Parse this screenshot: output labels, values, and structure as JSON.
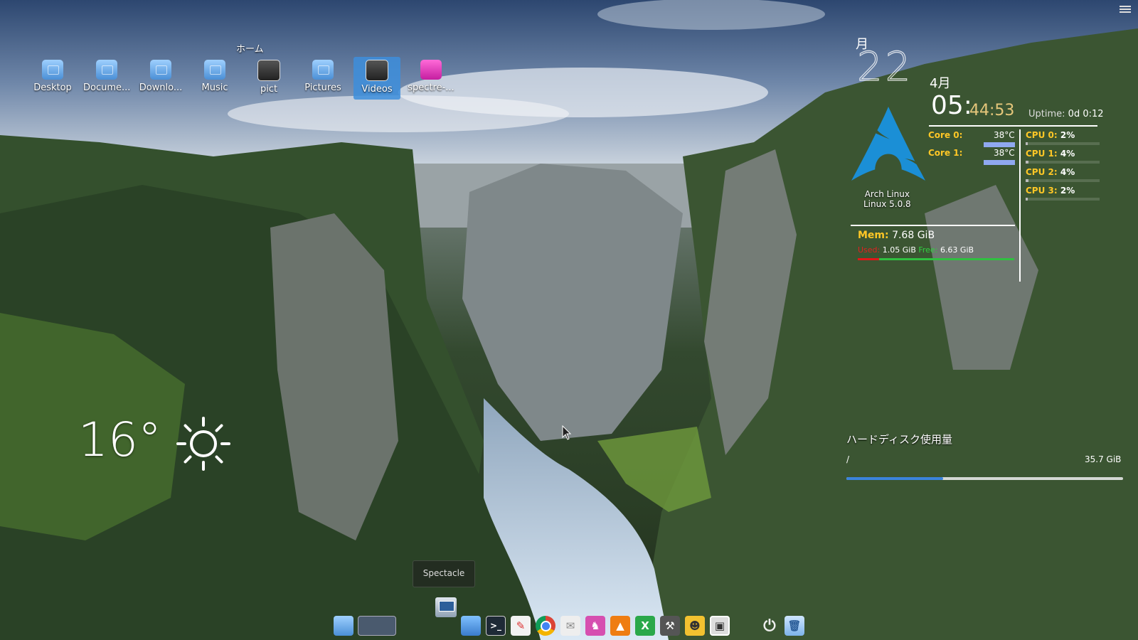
{
  "desktop": {
    "folder_title": "ホーム",
    "icons": [
      {
        "label": "Desktop",
        "icon": "desktop-folder-icon"
      },
      {
        "label": "Docume...",
        "icon": "documents-folder-icon"
      },
      {
        "label": "Downlo...",
        "icon": "downloads-folder-icon"
      },
      {
        "label": "Music",
        "icon": "music-folder-icon"
      },
      {
        "label": "pict",
        "icon": "image-thumbnail-icon"
      },
      {
        "label": "Pictures",
        "icon": "pictures-folder-icon"
      },
      {
        "label": "Videos",
        "icon": "video-thumbnail-icon",
        "selected": true
      },
      {
        "label": "spectre-...",
        "icon": "pink-document-icon"
      }
    ]
  },
  "clock": {
    "day_of_week": "月",
    "day": "22",
    "month": "4月",
    "hours_minutes": "05:",
    "minutes_seconds": "44:53",
    "uptime_label": "Uptime:",
    "uptime_value": "0d 0:12"
  },
  "system": {
    "distro": "Arch Linux",
    "kernel": "Linux 5.0.8",
    "cores": [
      {
        "label": "Core 0:",
        "temp": "38°C"
      },
      {
        "label": "Core 1:",
        "temp": "38°C"
      }
    ],
    "cpus": [
      {
        "label": "CPU 0:",
        "value": "2%",
        "percent": 2
      },
      {
        "label": "CPU 1:",
        "value": "4%",
        "percent": 4
      },
      {
        "label": "CPU 2:",
        "value": "4%",
        "percent": 4
      },
      {
        "label": "CPU 3:",
        "value": "2%",
        "percent": 2
      }
    ],
    "memory": {
      "label": "Mem:",
      "total": "7.68 GiB",
      "used_label": "Used:",
      "used": "1.05 GiB",
      "free_label": "Free:",
      "free": "6.63 GiB",
      "used_fraction": 0.137
    }
  },
  "disk": {
    "title": "ハードディスク使用量",
    "mount": "/",
    "size": "35.7 GiB",
    "used_fraction": 0.35
  },
  "weather": {
    "temperature": "16°",
    "condition_icon": "sun-icon"
  },
  "dock": {
    "tooltip": "Spectacle",
    "icons": [
      "file-manager-icon",
      "virtual-desktops-icon",
      "folder-icon",
      "terminal-icon",
      "text-editor-icon",
      "chrome-icon",
      "mail-icon",
      "catfish-icon",
      "vlc-icon",
      "spreadsheet-icon",
      "settings-wrench-icon",
      "pacman-ghost-icon",
      "image-viewer-icon",
      "power-icon",
      "trash-icon"
    ]
  },
  "colors": {
    "accent": "#3b84dc",
    "label_yellow": "#ffc726",
    "mem_used": "#e01818",
    "mem_free": "#30c040"
  }
}
